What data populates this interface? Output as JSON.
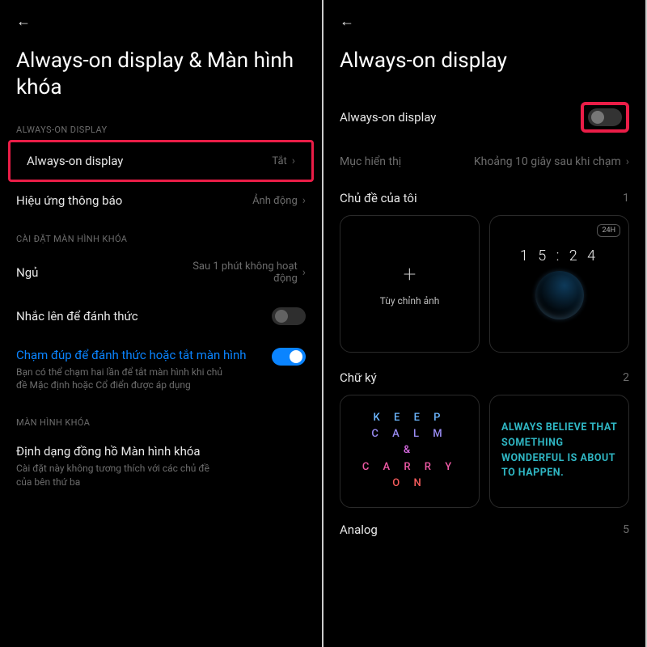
{
  "left": {
    "title": "Always-on display & Màn hình khóa",
    "section_aod": "ALWAYS-ON DISPLAY",
    "aod_row": {
      "label": "Always-on display",
      "value": "Tắt"
    },
    "notif_row": {
      "label": "Hiệu ứng thông báo",
      "value": "Ảnh động"
    },
    "section_lock": "CÀI ĐẶT MÀN HÌNH KHÓA",
    "sleep_row": {
      "label": "Ngủ",
      "value": "Sau 1 phút không hoạt động"
    },
    "raise_row": {
      "label": "Nhắc lên để đánh thức"
    },
    "double_tap_row": {
      "label": "Chạm đúp để đánh thức hoặc tắt màn hình",
      "sub": "Bạn có thể chạm hai lần để tắt màn hình khi chủ đề Mặc định hoặc Cổ điển được áp dụng"
    },
    "section_lockscreen": "MÀN HÌNH KHÓA",
    "clock_format": {
      "label": "Định dạng đồng hồ Màn hình khóa",
      "sub": "Cài đặt này không tương thích với các chủ đề của bên thứ ba"
    }
  },
  "right": {
    "title": "Always-on display",
    "aod_toggle_label": "Always-on display",
    "display_items": {
      "label": "Mục hiển thị",
      "value": "Khoảng 10 giây sau khi chạm"
    },
    "my_themes": {
      "label": "Chủ đề của tôi",
      "count": "1"
    },
    "custom_image": "Tùy chỉnh ảnh",
    "clock_value": "1 5 : 2 4",
    "badge24": "24H",
    "signatures": {
      "label": "Chữ ký",
      "count": "2"
    },
    "sig1": {
      "l1": "K E E P",
      "l2": "C A L M",
      "l3": "&",
      "l4": "C A R R Y",
      "l5": "O N"
    },
    "sig2": "ALWAYS BELIEVE THAT SOMETHING WONDERFUL IS ABOUT TO HAPPEN.",
    "analog": {
      "label": "Analog",
      "count": "5"
    }
  }
}
